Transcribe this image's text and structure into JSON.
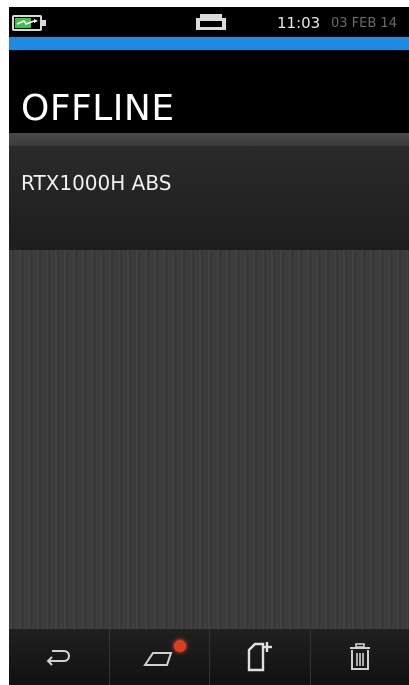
{
  "status_bar": {
    "time": "11:03",
    "date": "03 FEB 14",
    "battery_icon": "battery-charging-icon",
    "connection_icon": "usb-icon"
  },
  "header": {
    "title": "OFFLINE"
  },
  "list": {
    "items": [
      {
        "label": "RTX1000H ABS"
      }
    ]
  },
  "bottom_bar": {
    "buttons": [
      {
        "icon": "back-icon"
      },
      {
        "icon": "home-icon",
        "notification": true
      },
      {
        "icon": "new-document-icon"
      },
      {
        "icon": "trash-icon"
      }
    ]
  },
  "colors": {
    "accent_bar": "#1c8be0",
    "battery_fill": "#3fc04a",
    "notification_dot": "#e23a1d"
  }
}
